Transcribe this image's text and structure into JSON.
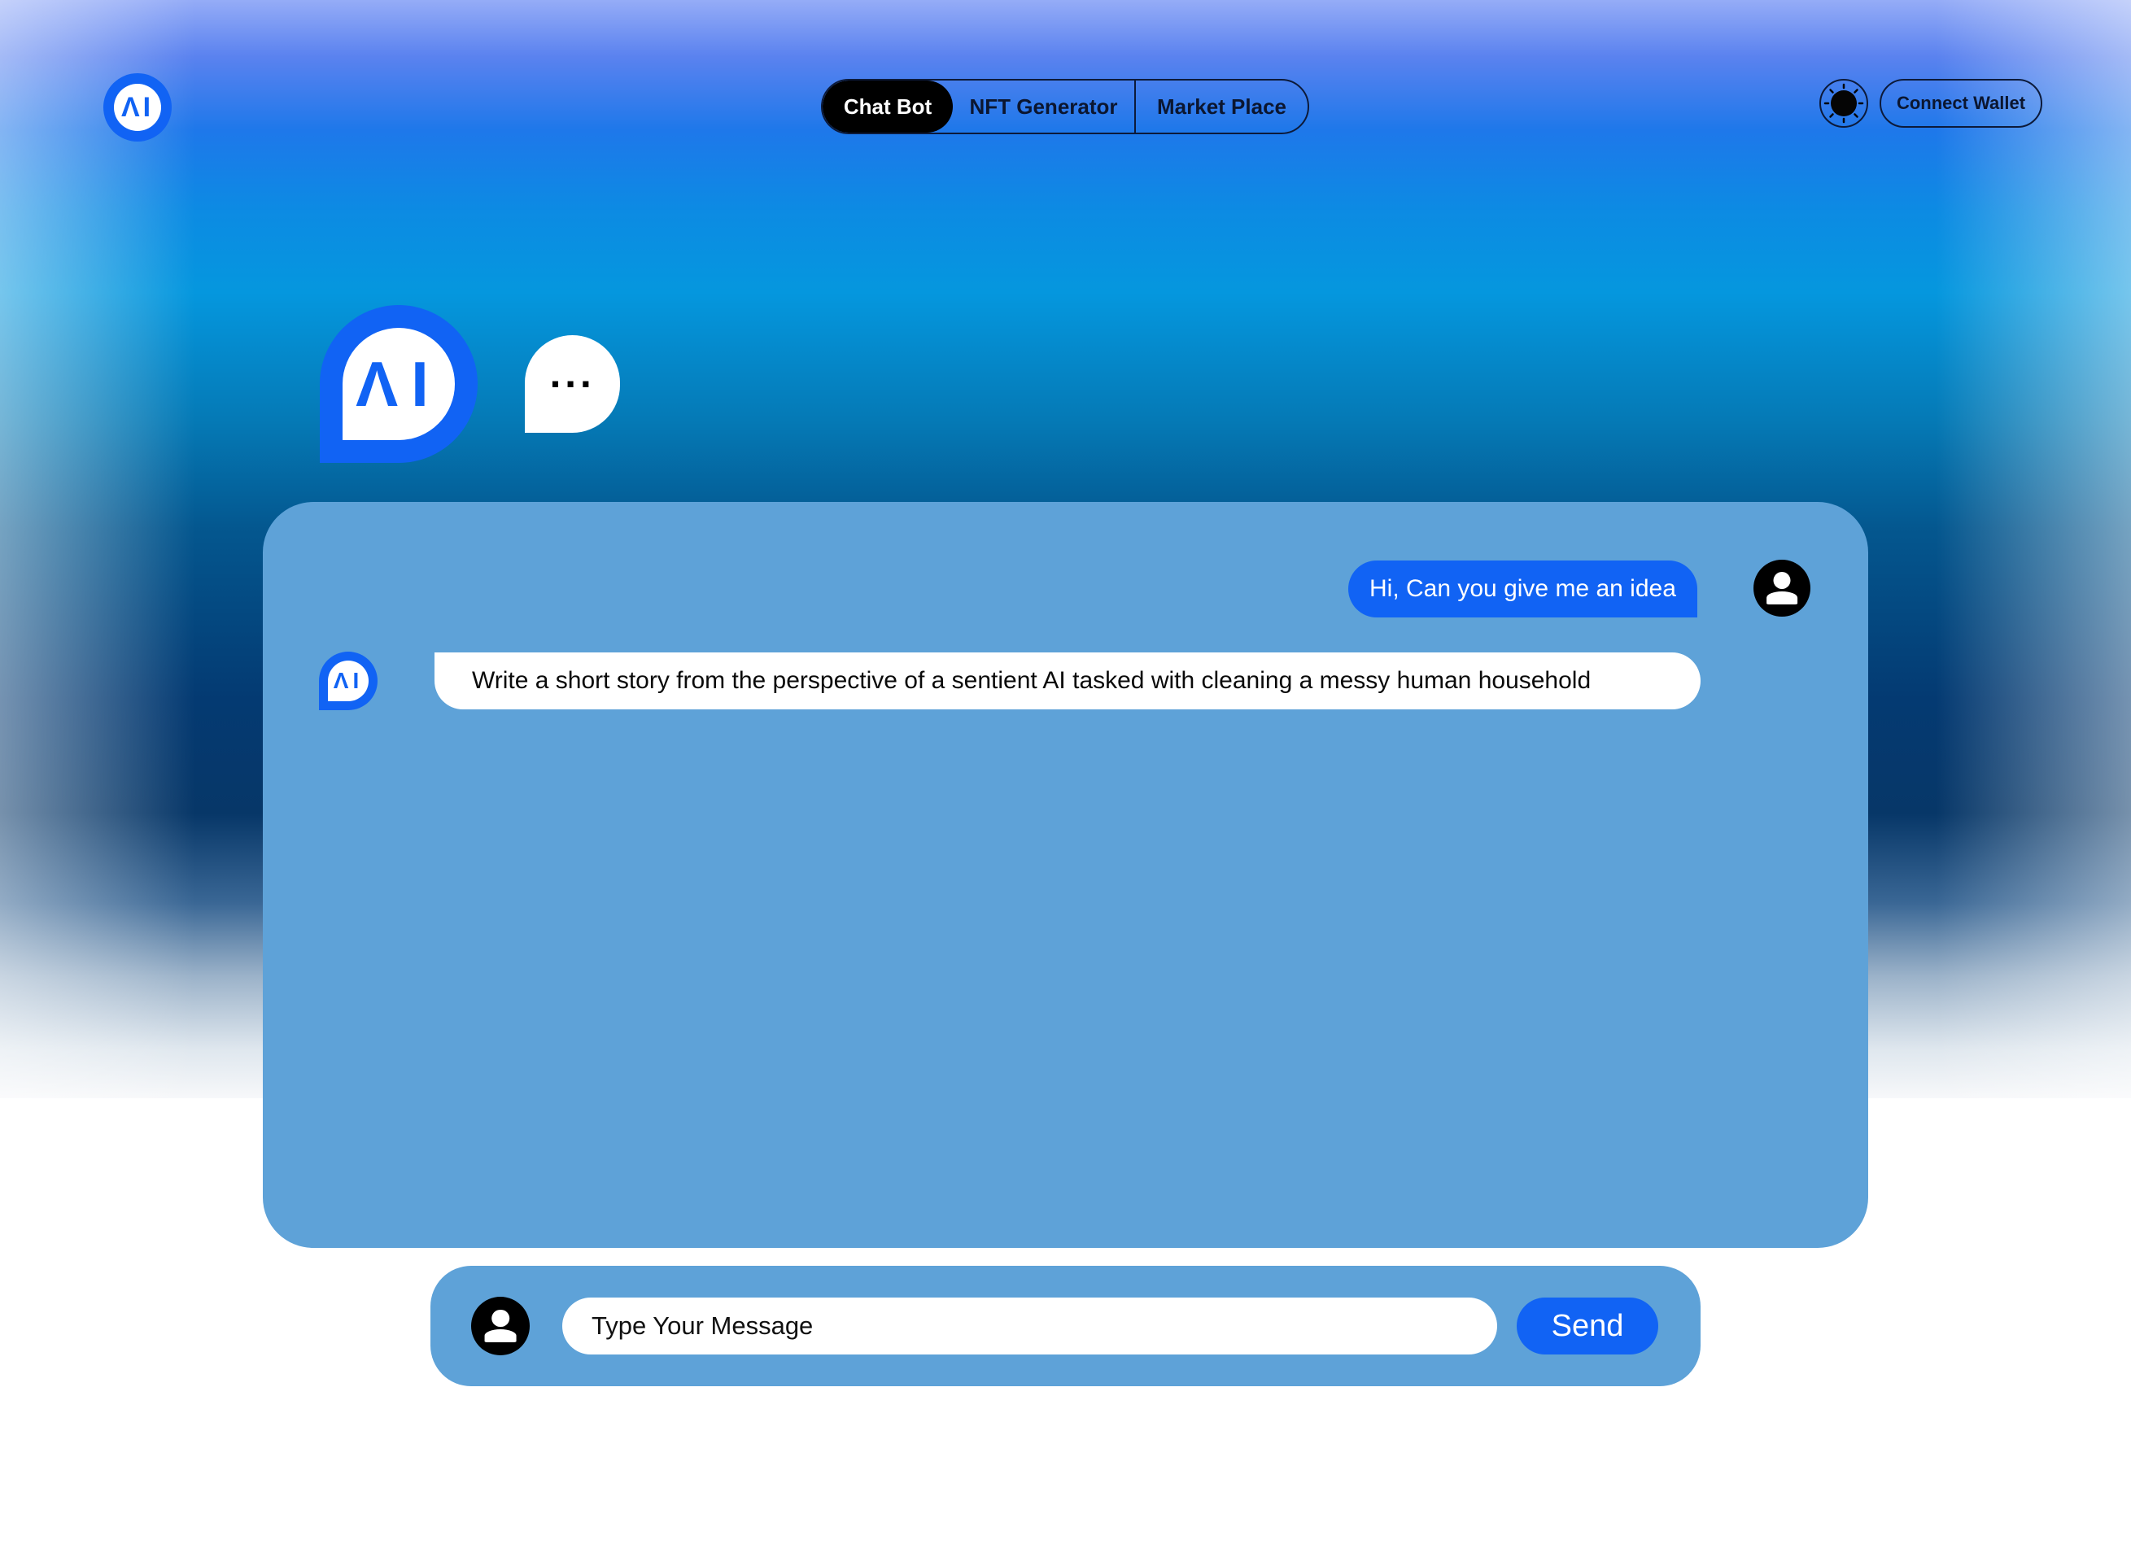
{
  "header": {
    "logo_text": "ΛI",
    "nav_tabs": [
      {
        "label": "Chat Bot",
        "active": true
      },
      {
        "label": "NFT Generator",
        "active": false
      },
      {
        "label": "Market Place",
        "active": false
      }
    ],
    "theme_toggle_icon": "sun-icon",
    "connect_wallet_label": "Connect Wallet"
  },
  "bot": {
    "avatar_text": "ΛI",
    "typing_indicator": "···"
  },
  "chat": {
    "messages": [
      {
        "sender": "user",
        "text": "Hi, Can you give me an idea"
      },
      {
        "sender": "bot",
        "text": "Write a short story from the perspective of a sentient AI tasked with cleaning a messy human household"
      }
    ]
  },
  "composer": {
    "placeholder": "Type Your Message",
    "send_label": "Send"
  },
  "colors": {
    "accent": "#1163f4",
    "panel": "#5ea2d8",
    "dark": "#000000"
  }
}
